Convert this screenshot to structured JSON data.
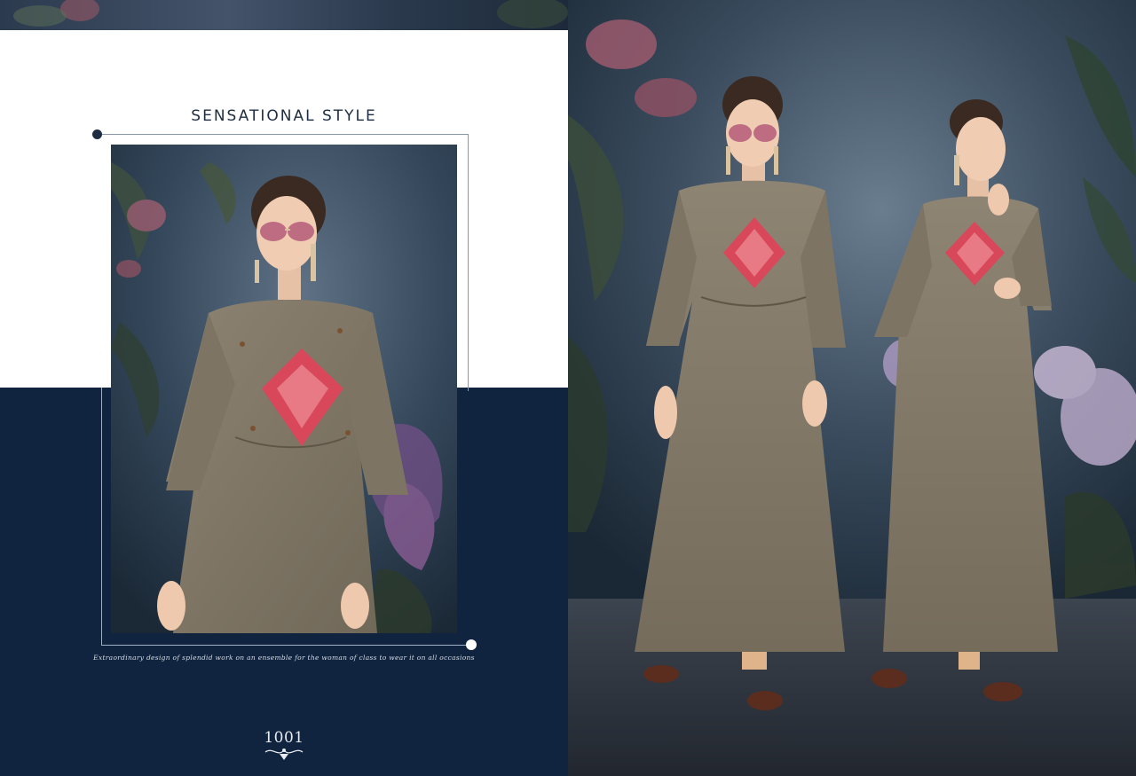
{
  "brochure": {
    "headline": "SENSATIONAL STYLE",
    "tagline": "Extraordinary design of splendid work on an ensemble for the woman of class to wear it on all occasions",
    "design_number": "1001"
  },
  "colors": {
    "navy": "#10243f",
    "white": "#ffffff",
    "fabric": "#857b6b",
    "embroidery": "#d8475a",
    "backdrop": "#2e3f52"
  },
  "images": {
    "left_photo": "model-closeup-photo",
    "right_photo": "two-models-full-length-photo"
  }
}
